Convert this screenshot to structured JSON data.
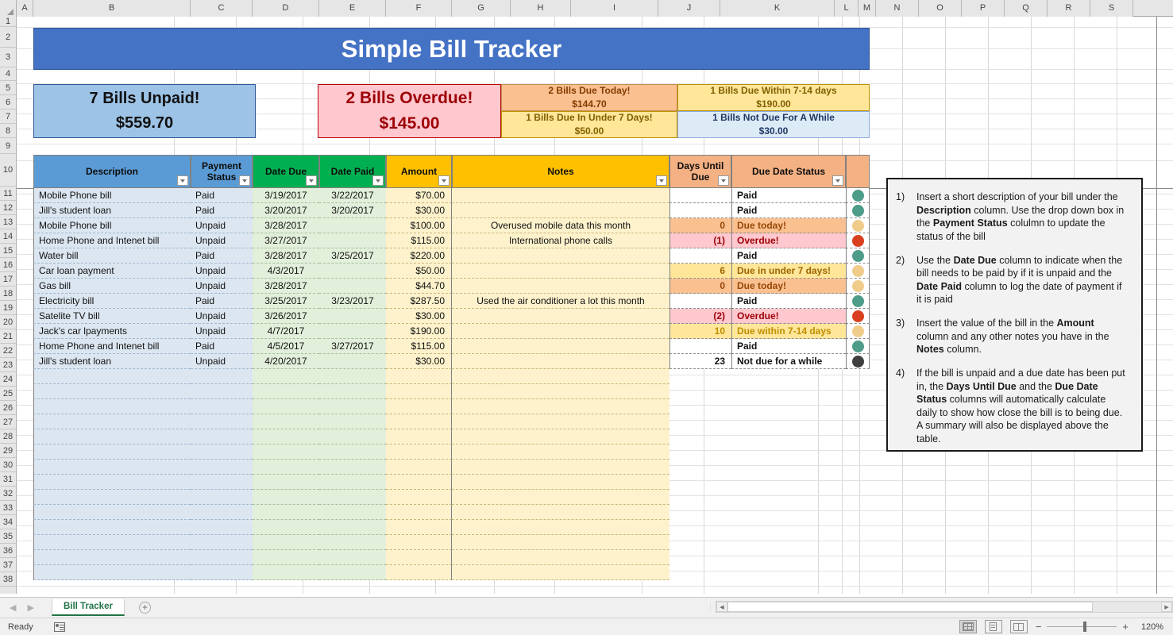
{
  "app": {
    "columns": [
      "A",
      "B",
      "C",
      "D",
      "E",
      "F",
      "G",
      "H",
      "I",
      "J",
      "K",
      "L",
      "M",
      "N",
      "O",
      "P",
      "Q",
      "R",
      "S"
    ],
    "rows": [
      1,
      2,
      3,
      4,
      5,
      6,
      7,
      8,
      9,
      10,
      11,
      12,
      13,
      14,
      15,
      16,
      17,
      18,
      19,
      20,
      21,
      22,
      23,
      24,
      25,
      26,
      27,
      28,
      29,
      30,
      31,
      32,
      33,
      34,
      35,
      36,
      37,
      38
    ]
  },
  "title": "Simple Bill Tracker",
  "summary": {
    "unpaid": {
      "line1": "7 Bills Unpaid!",
      "line2": "$559.70"
    },
    "overdue": {
      "line1": "2 Bills Overdue!",
      "line2": "$145.00"
    },
    "due_today": {
      "line1": "2 Bills Due Today!",
      "line2": "$144.70"
    },
    "under_7": {
      "line1": "1 Bills Due In Under 7 Days!",
      "line2": "$50.00"
    },
    "within_7_14": {
      "line1": "1 Bills Due Within 7-14 days",
      "line2": "$190.00"
    },
    "not_due": {
      "line1": "1 Bills Not Due For A While",
      "line2": "$30.00"
    }
  },
  "table": {
    "headers": {
      "description": "Description",
      "payment_status_l1": "Payment",
      "payment_status_l2": "Status",
      "date_due": "Date Due",
      "date_paid": "Date Paid",
      "amount": "Amount",
      "notes": "Notes",
      "days_until_due_l1": "Days Until",
      "days_until_due_l2": "Due",
      "due_date_status": "Due Date Status"
    },
    "rows": [
      {
        "row": 11,
        "description": "Mobile Phone bill",
        "payment_status": "Paid",
        "date_due": "3/19/2017",
        "date_paid": "3/22/2017",
        "amount": "$70.00",
        "notes": "",
        "days_until_due": "",
        "status": "Paid",
        "status_kind": "paid",
        "dot_color": "#4e9c8a"
      },
      {
        "row": 12,
        "description": "Jill's student loan",
        "payment_status": "Paid",
        "date_due": "3/20/2017",
        "date_paid": "3/20/2017",
        "amount": "$30.00",
        "notes": "",
        "days_until_due": "",
        "status": "Paid",
        "status_kind": "paid",
        "dot_color": "#4e9c8a"
      },
      {
        "row": 13,
        "description": "Mobile Phone bill",
        "payment_status": "Unpaid",
        "date_due": "3/28/2017",
        "date_paid": "",
        "amount": "$100.00",
        "notes": "Overused mobile data this month",
        "days_until_due": "0",
        "status": "Due today!",
        "status_kind": "today",
        "dot_color": "#f0cc8a"
      },
      {
        "row": 14,
        "description": "Home Phone and Intenet bill",
        "payment_status": "Unpaid",
        "date_due": "3/27/2017",
        "date_paid": "",
        "amount": "$115.00",
        "notes": "International phone calls",
        "days_until_due": "(1)",
        "status": "Overdue!",
        "status_kind": "overdue",
        "dot_color": "#d9401f"
      },
      {
        "row": 15,
        "description": "Water bill",
        "payment_status": "Paid",
        "date_due": "3/28/2017",
        "date_paid": "3/25/2017",
        "amount": "$220.00",
        "notes": "",
        "days_until_due": "",
        "status": "Paid",
        "status_kind": "paid",
        "dot_color": "#4e9c8a"
      },
      {
        "row": 16,
        "description": "Car loan payment",
        "payment_status": "Unpaid",
        "date_due": "4/3/2017",
        "date_paid": "",
        "amount": "$50.00",
        "notes": "",
        "days_until_due": "6",
        "status": "Due in under 7 days!",
        "status_kind": "u7",
        "dot_color": "#f0cc8a"
      },
      {
        "row": 17,
        "description": "Gas bill",
        "payment_status": "Unpaid",
        "date_due": "3/28/2017",
        "date_paid": "",
        "amount": "$44.70",
        "notes": "",
        "days_until_due": "0",
        "status": "Due today!",
        "status_kind": "today",
        "dot_color": "#f0cc8a"
      },
      {
        "row": 18,
        "description": "Electricity bill",
        "payment_status": "Paid",
        "date_due": "3/25/2017",
        "date_paid": "3/23/2017",
        "amount": "$287.50",
        "notes": "Used the air conditioner a lot this month",
        "days_until_due": "",
        "status": "Paid",
        "status_kind": "paid",
        "dot_color": "#4e9c8a"
      },
      {
        "row": 19,
        "description": "Satelite TV bill",
        "payment_status": "Unpaid",
        "date_due": "3/26/2017",
        "date_paid": "",
        "amount": "$30.00",
        "notes": "",
        "days_until_due": "(2)",
        "status": "Overdue!",
        "status_kind": "overdue",
        "dot_color": "#d9401f"
      },
      {
        "row": 20,
        "description": "Jack's car lpayments",
        "payment_status": "Unpaid",
        "date_due": "4/7/2017",
        "date_paid": "",
        "amount": "$190.00",
        "notes": "",
        "days_until_due": "10",
        "status": "Due within 7-14 days",
        "status_kind": "714",
        "dot_color": "#f0cc8a"
      },
      {
        "row": 21,
        "description": "Home Phone and Intenet bill",
        "payment_status": "Paid",
        "date_due": "4/5/2017",
        "date_paid": "3/27/2017",
        "amount": "$115.00",
        "notes": "",
        "days_until_due": "",
        "status": "Paid",
        "status_kind": "paid",
        "dot_color": "#4e9c8a"
      },
      {
        "row": 22,
        "description": "Jill's student loan",
        "payment_status": "Unpaid",
        "date_due": "4/20/2017",
        "date_paid": "",
        "amount": "$30.00",
        "notes": "",
        "days_until_due": "23",
        "status": "Not due for a while",
        "status_kind": "while",
        "dot_color": "#3f3f3f"
      }
    ]
  },
  "instructions": [
    {
      "num": "1)",
      "html": "Insert a short description of your bill  under the <b>Description</b> column. Use the drop down box in the <b>Payment Status</b> colulmn to update the status of the bill"
    },
    {
      "num": "2)",
      "html": "Use the <b>Date Due</b>  column to indicate when the bill needs to be paid by if it is unpaid and the <b>Date Paid</b> column to log the date of payment if it is paid"
    },
    {
      "num": "3)",
      "html": "Insert the value of the bill in the <b>Amount</b> column and any other notes you have in the <b>Notes</b> column."
    },
    {
      "num": "4)",
      "html": "If the bill is unpaid and a due date has been put in, the <b>Days Until Due</b> and the <b>Due Date Status</b> columns will automatically calculate daily to show how close the bill is to being due. A summary will also be displayed above the table."
    }
  ],
  "sheet": {
    "tab_name": "Bill Tracker",
    "add_label": "+"
  },
  "statusbar": {
    "ready": "Ready",
    "zoom": "120%"
  },
  "colors": {
    "banner": "#4472c4",
    "unpaid_box": "#9dc3e6",
    "overdue_box": "#ffc7ce",
    "due_today_box": "#fac090",
    "yellow_box": "#ffe699",
    "not_due_box": "#ddebf7",
    "header_blue": "#5b9bd5",
    "header_green": "#00b050",
    "header_amber": "#ffc000",
    "header_peach": "#f4b183"
  }
}
